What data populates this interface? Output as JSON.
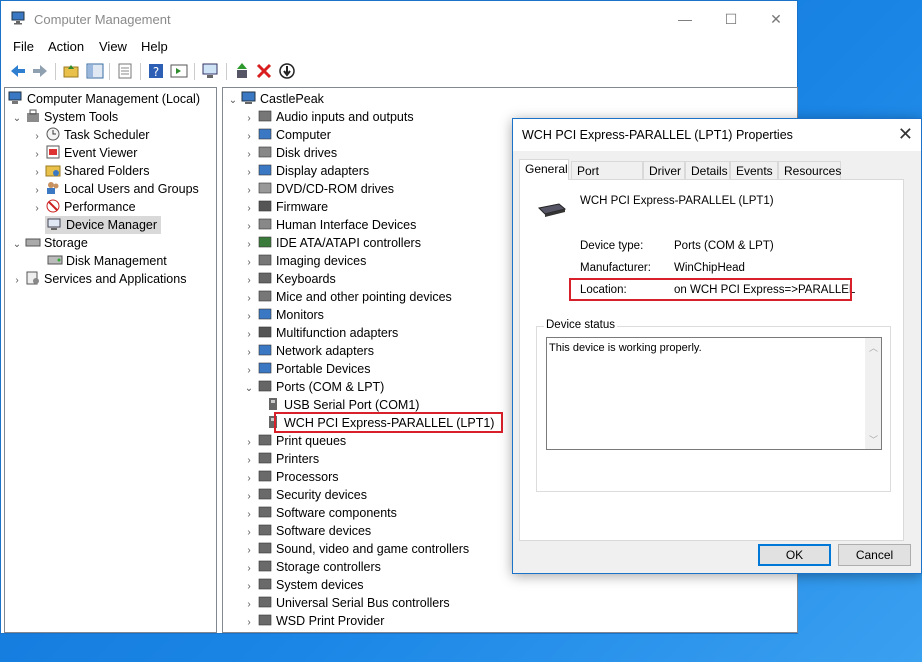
{
  "window": {
    "title": "Computer Management",
    "minimize": "—",
    "maximize": "☐",
    "close": "✕"
  },
  "menu": [
    "File",
    "Action",
    "View",
    "Help"
  ],
  "left_tree": [
    {
      "label": "Computer Management (Local)",
      "icon": "computer-management-icon"
    },
    {
      "label": "System Tools",
      "icon": "tools-icon"
    },
    {
      "label": "Task Scheduler",
      "icon": "clock-icon"
    },
    {
      "label": "Event Viewer",
      "icon": "event-viewer-icon"
    },
    {
      "label": "Shared Folders",
      "icon": "shared-folder-icon"
    },
    {
      "label": "Local Users and Groups",
      "icon": "users-icon"
    },
    {
      "label": "Performance",
      "icon": "performance-icon"
    },
    {
      "label": "Device Manager",
      "icon": "device-manager-icon"
    },
    {
      "label": "Storage",
      "icon": "storage-icon"
    },
    {
      "label": "Disk Management",
      "icon": "disk-icon"
    },
    {
      "label": "Services and Applications",
      "icon": "services-icon"
    }
  ],
  "device_tree": {
    "root": "CastlePeak",
    "categories": [
      "Audio inputs and outputs",
      "Computer",
      "Disk drives",
      "Display adapters",
      "DVD/CD-ROM drives",
      "Firmware",
      "Human Interface Devices",
      "IDE ATA/ATAPI controllers",
      "Imaging devices",
      "Keyboards",
      "Mice and other pointing devices",
      "Monitors",
      "Multifunction adapters",
      "Network adapters",
      "Portable Devices",
      "Ports (COM & LPT)"
    ],
    "ports_children": [
      "USB Serial Port (COM1)",
      "WCH PCI Express-PARALLEL (LPT1)"
    ],
    "after_ports": [
      "Print queues",
      "Printers",
      "Processors",
      "Security devices",
      "Software components",
      "Software devices",
      "Sound, video and game controllers",
      "Storage controllers",
      "System devices",
      "Universal Serial Bus controllers",
      "WSD Print Provider"
    ]
  },
  "dialog": {
    "title": "WCH PCI Express-PARALLEL (LPT1) Properties",
    "close": "✕",
    "tabs": [
      "General",
      "Port Settings",
      "Driver",
      "Details",
      "Events",
      "Resources"
    ],
    "device_name": "WCH PCI Express-PARALLEL (LPT1)",
    "fields": {
      "device_type_label": "Device type:",
      "device_type": "Ports (COM & LPT)",
      "manufacturer_label": "Manufacturer:",
      "manufacturer": "WinChipHead",
      "location_label": "Location:",
      "location": "on WCH PCI Express=>PARALLEL"
    },
    "status_caption": "Device status",
    "status_text": "This device is working properly.",
    "ok": "OK",
    "cancel": "Cancel"
  },
  "colors": {
    "accent": "#1a73c8",
    "highlight_box": "#d8202a",
    "desktop": "#1a7ad4"
  }
}
